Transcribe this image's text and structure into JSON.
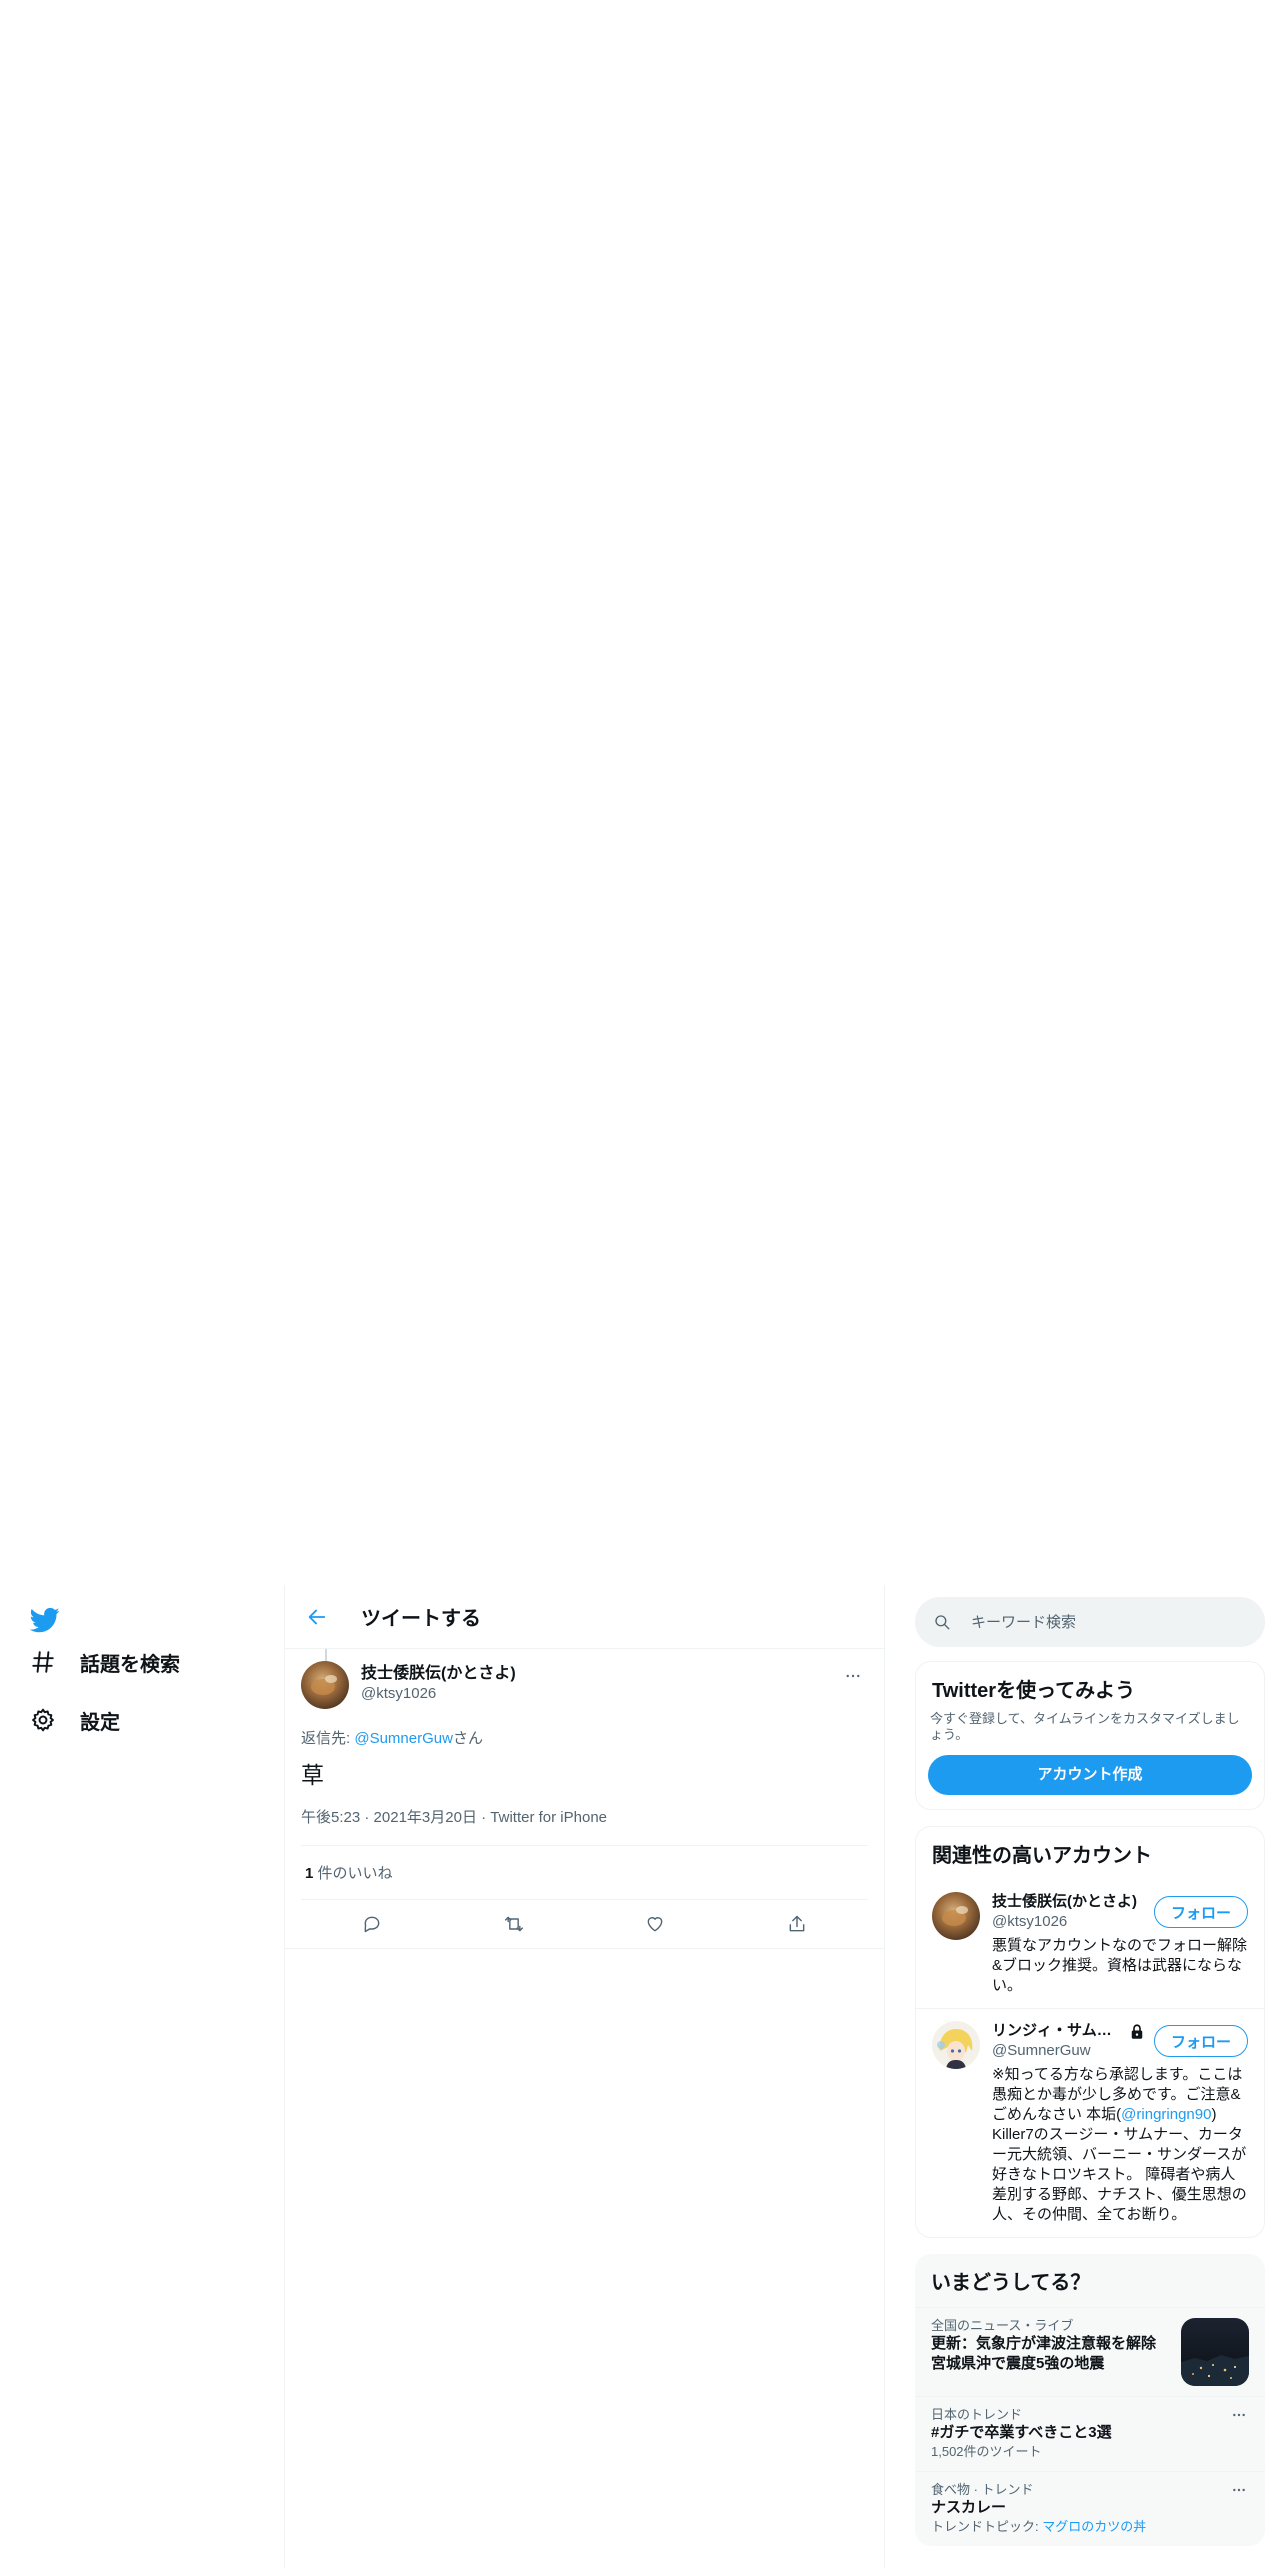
{
  "nav": {
    "items": [
      {
        "label": "話題を検索",
        "icon": "hashtag-icon"
      },
      {
        "label": "設定",
        "icon": "gear-icon"
      }
    ]
  },
  "header": {
    "title": "ツイートする"
  },
  "tweet": {
    "display_name": "技士倭朕伝(かとさよ)",
    "handle": "@ktsy1026",
    "replying_prefix": "返信先: ",
    "replying_to": "@SumnerGuw",
    "replying_suffix": "さん",
    "text": "草",
    "time": "午後5:23",
    "sep": " · ",
    "date": "2021年3月20日",
    "source": "Twitter for iPhone",
    "likes_count": "1",
    "likes_label": " 件のいいね"
  },
  "search": {
    "placeholder": "キーワード検索"
  },
  "signup": {
    "title": "Twitterを使ってみよう",
    "desc": "今すぐ登録して、タイムラインをカスタマイズしましょう。",
    "button": "アカウント作成"
  },
  "related": {
    "title": "関連性の高いアカウント",
    "follow_label": "フォロー",
    "accounts": [
      {
        "display_name": "技士倭朕伝(かとさよ)",
        "handle": "@ktsy1026",
        "bio": "悪質なアカウントなのでフォロー解除&ブロック推奨。資格は武器にならない。"
      },
      {
        "display_name": "リンジィ・サムナー",
        "handle": "@SumnerGuw",
        "bio_a": "※知ってる方なら承認します。ここは愚痴とか毒が少し多めです。ご注意&ごめんなさい 本垢(",
        "bio_link": "@ringringn90",
        "bio_b": ") Killer7のスージー・サムナー、カーター元大統領、バーニー・サンダースが好きなトロツキスト。 障碍者や病人差別する野郎、ナチスト、優生思想の人、その仲間、全てお断り。"
      }
    ]
  },
  "trends": {
    "title": "いまどうしてる？",
    "items": [
      {
        "meta": "全国のニュース・ライブ",
        "title": "更新：気象庁が津波注意報を解除 宮城県沖で震度5強の地震"
      },
      {
        "meta": "日本のトレンド",
        "title": "#ガチで卒業すべきこと3選",
        "count": "1,502件のツイート"
      },
      {
        "meta": "食べ物 · トレンド",
        "title": "ナスカレー",
        "count_prefix": "トレンドトピック: ",
        "count_link": "マグロのカツの丼"
      }
    ]
  },
  "colors": {
    "accent": "#1d9bf0",
    "text": "#0f1419",
    "muted": "#536471"
  }
}
